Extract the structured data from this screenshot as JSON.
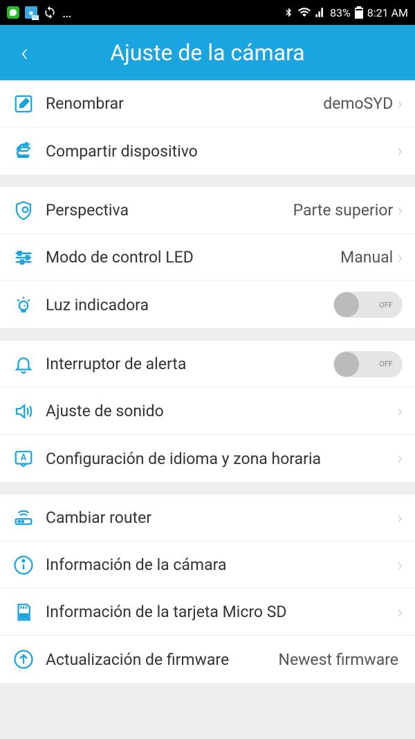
{
  "statusBar": {
    "battery": "83%",
    "time": "8:21 AM"
  },
  "header": {
    "title": "Ajuste de la cámara"
  },
  "sections": [
    {
      "rows": [
        {
          "label": "Renombrar",
          "value": "demoSYD"
        },
        {
          "label": "Compartir dispositivo"
        }
      ]
    },
    {
      "rows": [
        {
          "label": "Perspectiva",
          "value": "Parte superior"
        },
        {
          "label": "Modo de control LED",
          "value": "Manual"
        },
        {
          "label": "Luz indicadora",
          "toggle": "OFF"
        }
      ]
    },
    {
      "rows": [
        {
          "label": "Interruptor de alerta",
          "toggle": "OFF"
        },
        {
          "label": "Ajuste de sonido"
        },
        {
          "label": "Configuración de idioma y zona horaria"
        }
      ]
    },
    {
      "rows": [
        {
          "label": "Cambiar router"
        },
        {
          "label": "Información de la cámara"
        },
        {
          "label": "Información de la tarjeta Micro SD"
        },
        {
          "label": "Actualización de firmware",
          "value": "Newest firmware",
          "noChevron": true
        }
      ]
    }
  ]
}
